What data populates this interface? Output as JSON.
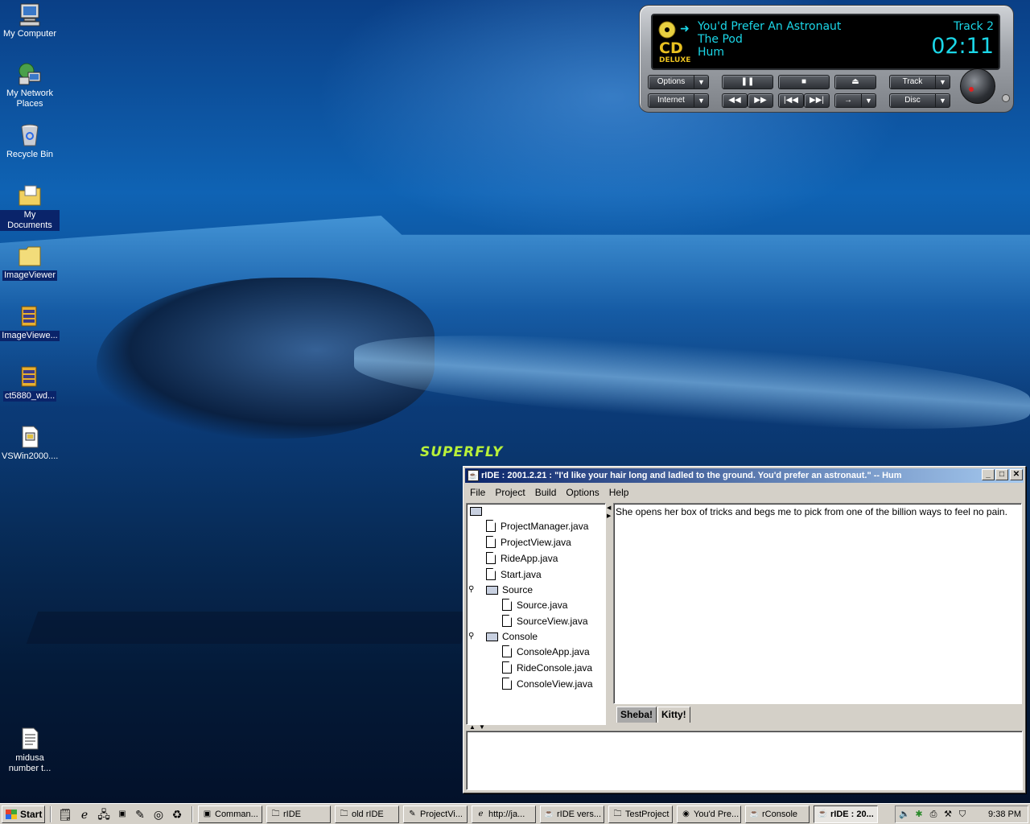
{
  "desktop": {
    "wallpaper_text": "SUPERFLY",
    "icons": [
      {
        "label": "My Computer",
        "icon": "my-computer-icon"
      },
      {
        "label": "My Network Places",
        "icon": "network-places-icon"
      },
      {
        "label": "Recycle Bin",
        "icon": "recycle-bin-icon"
      },
      {
        "label": "My Documents",
        "icon": "my-documents-icon"
      },
      {
        "label": "ImageViewer",
        "icon": "folder-icon"
      },
      {
        "label": "ImageViewe...",
        "icon": "archive-icon"
      },
      {
        "label": "ct5880_wd...",
        "icon": "archive-icon"
      },
      {
        "label": "VSWin2000....",
        "icon": "installer-icon"
      },
      {
        "label": "midusa number t...",
        "icon": "text-file-icon"
      }
    ]
  },
  "cd_player": {
    "logo_top": "CD",
    "logo_bottom": "DELUXE",
    "song": "You'd Prefer An Astronaut",
    "album": "The Pod",
    "artist": "Hum",
    "track": "Track 2",
    "time": "02:11",
    "buttons": {
      "options": "Options",
      "internet": "Internet",
      "track": "Track",
      "disc": "Disc",
      "pause": "❚❚",
      "stop": "■",
      "eject": "⏏",
      "rewind": "◀◀",
      "forward": "▶▶",
      "prev": "|◀◀",
      "next": "▶▶|",
      "mode": "→"
    }
  },
  "ride": {
    "title": "rIDE : 2001.2.21 : \"I'd like your hair long and ladled to the ground. You'd prefer an astronaut.\" -- Hum",
    "menu": [
      "File",
      "Project",
      "Build",
      "Options",
      "Help"
    ],
    "tree": {
      "files": [
        "ProjectManager.java",
        "ProjectView.java",
        "RideApp.java",
        "Start.java"
      ],
      "source_folder": "Source",
      "source_files": [
        "Source.java",
        "SourceView.java"
      ],
      "console_folder": "Console",
      "console_files": [
        "ConsoleApp.java",
        "RideConsole.java",
        "ConsoleView.java"
      ]
    },
    "editor_text": "She opens her box of tricks and begs me to pick from one of the billion ways to feel no pain.",
    "tabs": [
      "Sheba!",
      "Kitty!"
    ],
    "active_tab": "Sheba!"
  },
  "taskbar": {
    "start_label": "Start",
    "buttons": [
      {
        "label": "Comman...",
        "icon": "console-icon"
      },
      {
        "label": "rIDE",
        "icon": "folder-icon"
      },
      {
        "label": "old rIDE",
        "icon": "folder-icon"
      },
      {
        "label": "ProjectVi...",
        "icon": "document-icon"
      },
      {
        "label": "http://ja...",
        "icon": "browser-icon"
      },
      {
        "label": "rIDE vers...",
        "icon": "java-icon"
      },
      {
        "label": "TestProject",
        "icon": "folder-icon"
      },
      {
        "label": "You'd Pre...",
        "icon": "cd-icon"
      },
      {
        "label": "rConsole",
        "icon": "java-icon"
      },
      {
        "label": "rIDE : 20...",
        "icon": "java-icon",
        "active": true
      }
    ],
    "clock": "9:38 PM"
  }
}
